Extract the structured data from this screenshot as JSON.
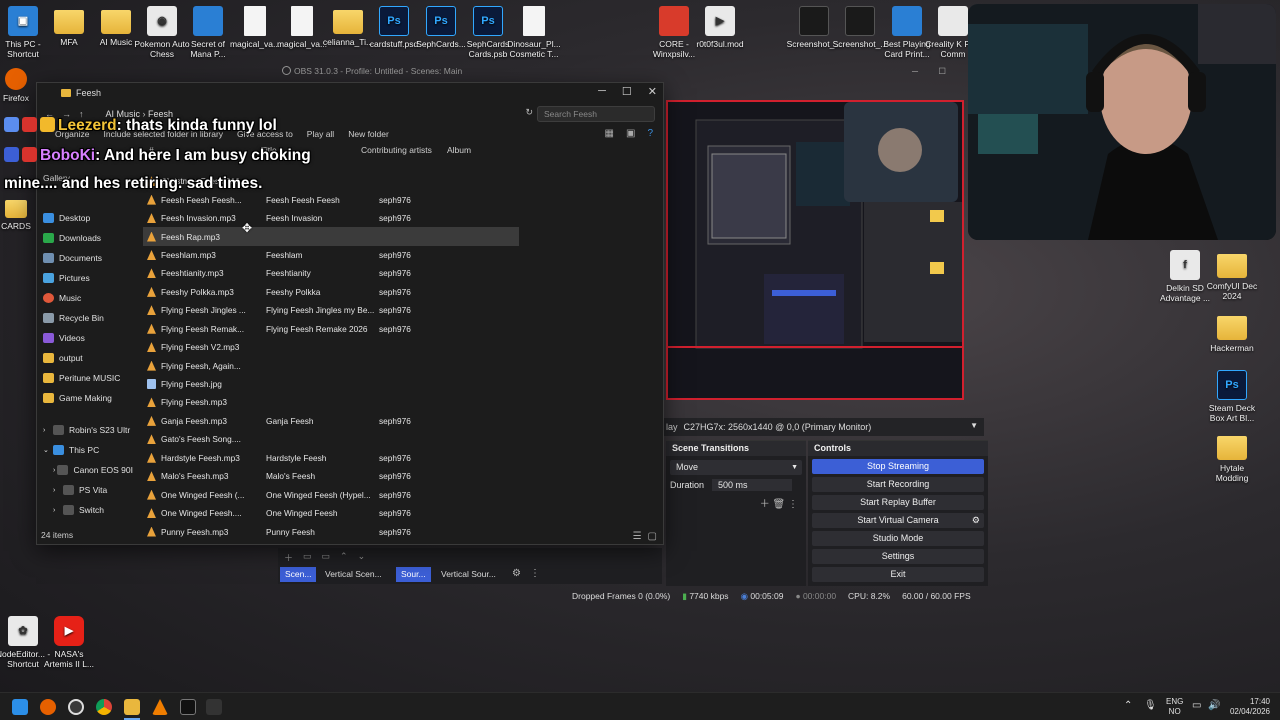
{
  "desktop_icons": [
    {
      "label": "This PC - Shortcut",
      "icon": "this-pc-icon"
    },
    {
      "label": "MFA",
      "icon": "folder-icon"
    },
    {
      "label": "AI Music",
      "icon": "folder-icon"
    },
    {
      "label": "Pokemon Auto Chess",
      "icon": "app-icon"
    },
    {
      "label": "Secret of Mana P...",
      "icon": "app-icon"
    },
    {
      "label": "magical_va...",
      "icon": "file-icon"
    },
    {
      "label": "magical_va...",
      "icon": "file-icon"
    },
    {
      "label": "celianna_Ti...",
      "icon": "folder-icon"
    },
    {
      "label": "cardstuff.psd",
      "icon": "photoshop-icon"
    },
    {
      "label": "SephCards...",
      "icon": "photoshop-icon"
    },
    {
      "label": "SephCards Cards.psb",
      "icon": "photoshop-icon"
    },
    {
      "label": "Dinosaur_Pl... Cosmetic T...",
      "icon": "file-icon"
    },
    {
      "label": "CORE - Winxpsilv...",
      "icon": "app-icon"
    },
    {
      "label": "r0t0f3ul.mod",
      "icon": "media-icon"
    },
    {
      "label": "Screenshot_...",
      "icon": "image-icon"
    },
    {
      "label": "Screenshot_...",
      "icon": "image-icon"
    },
    {
      "label": "Best Playing Card Print...",
      "icon": "app-icon"
    },
    {
      "label": "Creality K Plus Comm",
      "icon": "app-icon"
    },
    {
      "label": "Delkin SD Advantage ...",
      "icon": "app-icon"
    },
    {
      "label": "ComfyUI Dec 2024",
      "icon": "folder-icon"
    },
    {
      "label": "Hackerman",
      "icon": "folder-icon"
    },
    {
      "label": "Steam Deck Box Art Bl...",
      "icon": "photoshop-icon"
    },
    {
      "label": "Hytale Modding",
      "icon": "folder-icon"
    },
    {
      "label": "NodeEditor... - Shortcut",
      "icon": "app-icon"
    },
    {
      "label": "NASA's Artemis II L...",
      "icon": "youtube-icon"
    },
    {
      "label": "Firefox",
      "icon": "firefox-icon"
    },
    {
      "label": "CARDS",
      "icon": "folder-icon"
    }
  ],
  "explorer": {
    "title": "Feesh",
    "breadcrumb": [
      "AI Music",
      "Feesh"
    ],
    "search_placeholder": "Search Feesh",
    "commands": [
      "Organize",
      "Include selected folder in library",
      "Give access to",
      "Play all",
      "New folder"
    ],
    "columns": [
      "#",
      "Title",
      "Contributing artists",
      "Album"
    ],
    "nav": [
      {
        "label": "Gallery",
        "pinned": false
      },
      {
        "label": "Desktop",
        "pinned": true
      },
      {
        "label": "Downloads",
        "pinned": true
      },
      {
        "label": "Documents",
        "pinned": true
      },
      {
        "label": "Pictures",
        "pinned": true
      },
      {
        "label": "Music",
        "pinned": true
      },
      {
        "label": "Recycle Bin",
        "pinned": true
      },
      {
        "label": "Videos",
        "pinned": true
      },
      {
        "label": "output",
        "pinned": false
      },
      {
        "label": "Peritune MUSIC",
        "pinned": false
      },
      {
        "label": "Game Making",
        "pinned": false
      },
      {
        "label": "Robin's S23 Ultr",
        "pinned": false
      },
      {
        "label": "This PC",
        "pinned": false
      },
      {
        "label": "Canon EOS 90I",
        "pinned": false
      },
      {
        "label": "PS Vita",
        "pinned": false
      },
      {
        "label": "Switch",
        "pinned": false
      }
    ],
    "files": [
      {
        "name": "Christmas Feesh 202...",
        "title": "",
        "artist": "",
        "type": "mp3"
      },
      {
        "name": "Feesh Feesh Feesh...",
        "title": "Feesh Feesh Feesh",
        "artist": "seph976",
        "type": "mp3"
      },
      {
        "name": "Feesh Invasion.mp3",
        "title": "Feesh Invasion",
        "artist": "seph976",
        "type": "mp3"
      },
      {
        "name": "Feesh Rap.mp3",
        "title": "",
        "artist": "",
        "type": "mp3",
        "selected": true
      },
      {
        "name": "Feeshlam.mp3",
        "title": "Feeshlam",
        "artist": "seph976",
        "type": "mp3"
      },
      {
        "name": "Feeshtianity.mp3",
        "title": "Feeshtianity",
        "artist": "seph976",
        "type": "mp3"
      },
      {
        "name": "Feeshy Polkka.mp3",
        "title": "Feeshy Polkka",
        "artist": "seph976",
        "type": "mp3"
      },
      {
        "name": "Flying Feesh Jingles ...",
        "title": "Flying Feesh Jingles my Be...",
        "artist": "seph976",
        "type": "mp3"
      },
      {
        "name": "Flying Feesh Remak...",
        "title": "Flying Feesh Remake 2026",
        "artist": "seph976",
        "type": "mp3"
      },
      {
        "name": "Flying Feesh V2.mp3",
        "title": "",
        "artist": "",
        "type": "mp3"
      },
      {
        "name": "Flying Feesh, Again...",
        "title": "",
        "artist": "",
        "type": "mp3"
      },
      {
        "name": "Flying Feesh.jpg",
        "title": "",
        "artist": "",
        "type": "jpg"
      },
      {
        "name": "Flying Feesh.mp3",
        "title": "",
        "artist": "",
        "type": "mp3"
      },
      {
        "name": "Ganja Feesh.mp3",
        "title": "Ganja Feesh",
        "artist": "seph976",
        "type": "mp3"
      },
      {
        "name": "Gato's Feesh Song....",
        "title": "",
        "artist": "",
        "type": "mp3"
      },
      {
        "name": "Hardstyle Feesh.mp3",
        "title": "Hardstyle Feesh",
        "artist": "seph976",
        "type": "mp3"
      },
      {
        "name": "Malo's Feesh.mp3",
        "title": "Malo's Feesh",
        "artist": "seph976",
        "type": "mp3"
      },
      {
        "name": "One Winged Feesh (...",
        "title": "One Winged Feesh (Hypel...",
        "artist": "seph976",
        "type": "mp3"
      },
      {
        "name": "One Winged Feesh....",
        "title": "One Winged Feesh",
        "artist": "seph976",
        "type": "mp3"
      },
      {
        "name": "Punny Feesh.mp3",
        "title": "Punny Feesh",
        "artist": "seph976",
        "type": "mp3"
      }
    ],
    "status": "24 items"
  },
  "chat": [
    {
      "user": "Leezerd",
      "message": ": thats kinda funny lol",
      "color": "#f3c437"
    },
    {
      "user": "BoboKi",
      "message": ": And here I am busy choking",
      "color": "#d780ff"
    },
    {
      "user": "",
      "message": "mine.... and hes retiring. sad times.",
      "color": "#ffffff"
    }
  ],
  "obs": {
    "title": "OBS 31.0.3 - Profile: Untitled - Scenes: Main",
    "source_label": "lay",
    "source_select": "C27HG7x: 2560x1440 @ 0,0 (Primary Monitor)",
    "transitions": {
      "header": "Scene Transitions",
      "type": "Move",
      "duration_label": "Duration",
      "duration": "500 ms"
    },
    "controls": {
      "header": "Controls",
      "buttons": [
        "Stop Streaming",
        "Start Recording",
        "Start Replay Buffer",
        "Start Virtual Camera",
        "Studio Mode",
        "Settings",
        "Exit"
      ],
      "active": "Stop Streaming"
    },
    "scene_tabs": [
      "Scen...",
      "Vertical Scen...",
      "Sour...",
      "Vertical Sour..."
    ],
    "status": {
      "dropped_frames": "Dropped Frames 0 (0.0%)",
      "bitrate": "7740 kbps",
      "stream_time": "00:05:09",
      "rec_time": "00:00:00",
      "cpu": "CPU: 8.2%",
      "fps": "60.00 / 60.00 FPS"
    },
    "stream_color": "#d1202e",
    "accent": "#3c5fd6"
  },
  "taskbar": {
    "apps": [
      "start-icon",
      "firefox-icon",
      "obs-icon",
      "chrome-icon",
      "file-explorer-icon",
      "vlc-icon",
      "terminal-icon",
      "app-icon"
    ],
    "lang": "ENG",
    "region": "NO",
    "time": "17:40",
    "date": "02/04/2026"
  }
}
